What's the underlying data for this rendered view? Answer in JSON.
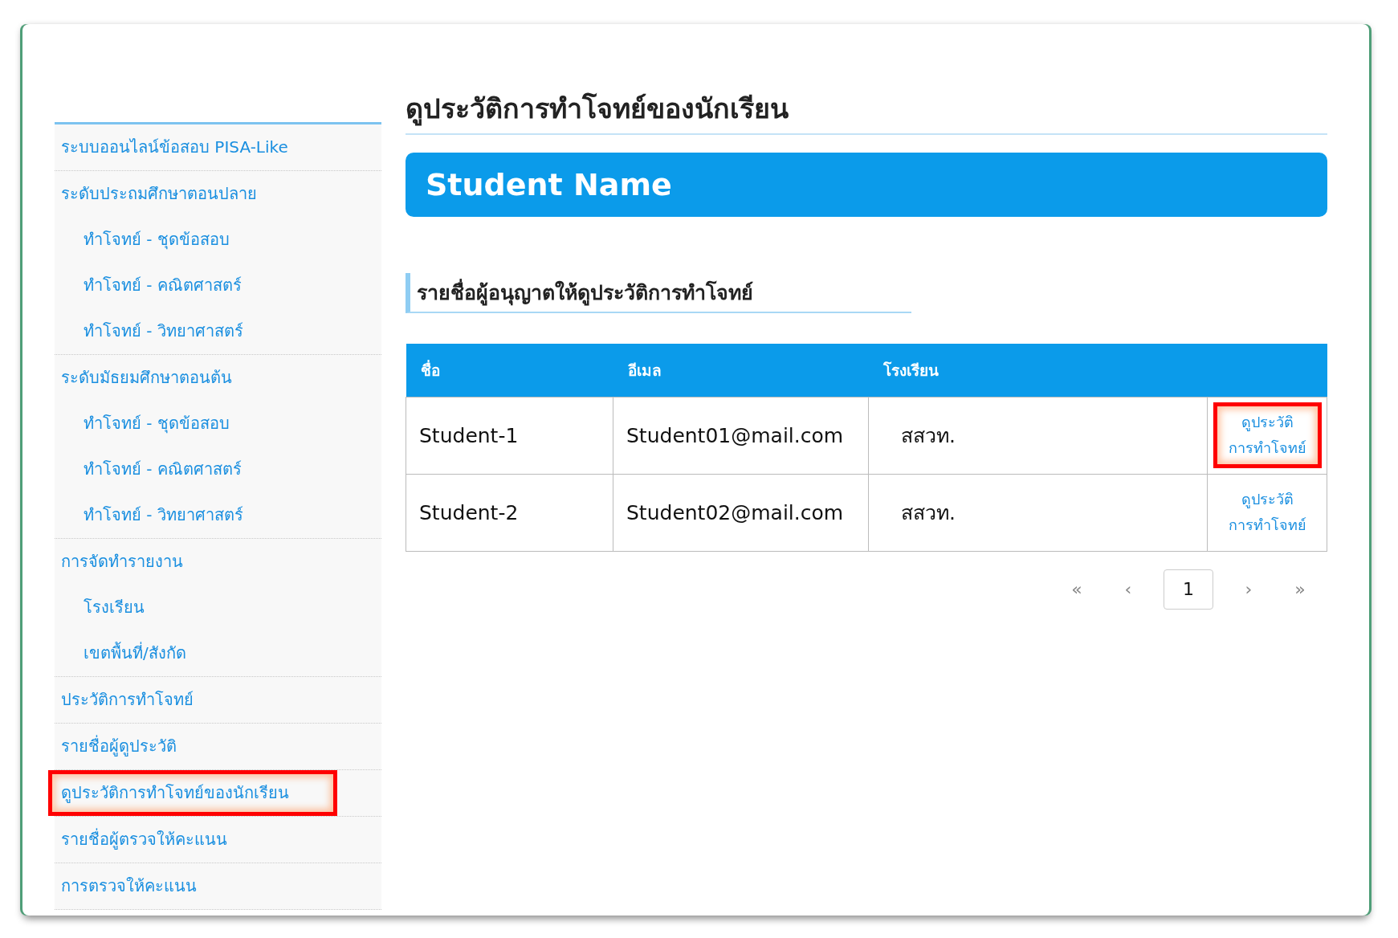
{
  "sidebar": {
    "items": [
      {
        "label": "ระบบออนไลน์ข้อสอบ PISA-Like",
        "highlighted": false
      },
      {
        "label": "ระดับประถมศึกษาตอนปลาย",
        "highlighted": false,
        "children": [
          {
            "label": "ทำโจทย์ - ชุดข้อสอบ"
          },
          {
            "label": "ทำโจทย์ - คณิตศาสตร์"
          },
          {
            "label": "ทำโจทย์ - วิทยาศาสตร์"
          }
        ]
      },
      {
        "label": "ระดับมัธยมศึกษาตอนต้น",
        "highlighted": false,
        "children": [
          {
            "label": "ทำโจทย์ - ชุดข้อสอบ"
          },
          {
            "label": "ทำโจทย์ - คณิตศาสตร์"
          },
          {
            "label": "ทำโจทย์ - วิทยาศาสตร์"
          }
        ]
      },
      {
        "label": "การจัดทำรายงาน",
        "highlighted": false,
        "children": [
          {
            "label": "โรงเรียน"
          },
          {
            "label": "เขตพื้นที่/สังกัด"
          }
        ]
      },
      {
        "label": "ประวัติการทำโจทย์",
        "highlighted": false
      },
      {
        "label": "รายชื่อผู้ดูประวัติ",
        "highlighted": false
      },
      {
        "label": "ดูประวัติการทำโจทย์ของนักเรียน",
        "highlighted": true
      },
      {
        "label": "รายชื่อผู้ตรวจให้คะแนน",
        "highlighted": false
      },
      {
        "label": "การตรวจให้คะแนน",
        "highlighted": false
      }
    ]
  },
  "page_title": "ดูประวัติการทำโจทย์ของนักเรียน",
  "banner": "Student Name",
  "section_title": "รายชื่อผู้อนุญาตให้ดูประวัติการทำโจทย์",
  "table": {
    "columns": [
      "ชื่อ",
      "อีเมล",
      "โรงเรียน"
    ],
    "rows": [
      {
        "name": "Student-1",
        "email": "Student01@mail.com",
        "school": "สสวท.",
        "link": "ดูประวัติ\nการทำโจทย์",
        "highlighted": true
      },
      {
        "name": "Student-2",
        "email": "Student02@mail.com",
        "school": "สสวท.",
        "link": "ดูประวัติ\nการทำโจทย์",
        "highlighted": false
      }
    ]
  },
  "pagination": [
    {
      "kind": "first",
      "label": "«",
      "selected": false
    },
    {
      "kind": "prev",
      "label": "‹",
      "selected": false
    },
    {
      "kind": "page",
      "label": "1",
      "selected": true
    },
    {
      "kind": "next",
      "label": "›",
      "selected": false
    },
    {
      "kind": "last",
      "label": "»",
      "selected": false
    }
  ]
}
